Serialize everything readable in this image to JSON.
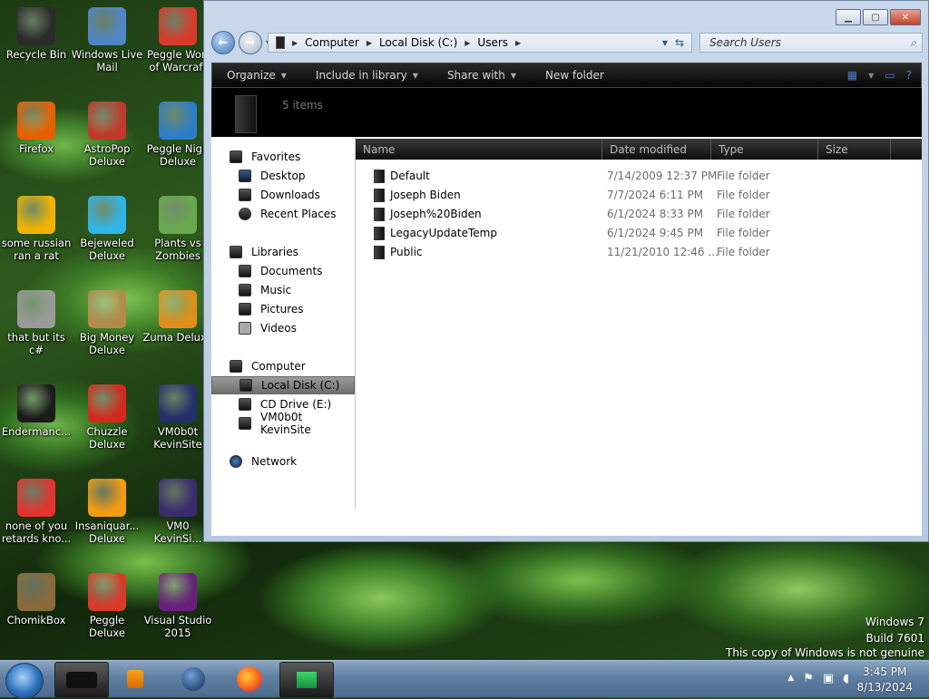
{
  "desktop": {
    "icons": [
      {
        "label": "Recycle Bin",
        "icon": "recycle-bin-icon",
        "color": "#2b2b2b"
      },
      {
        "label": "Windows Live\nMail",
        "icon": "mail-icon",
        "color": "#4f86c6"
      },
      {
        "label": "Peggle Worl\nof Warcraft",
        "icon": "peggle-icon",
        "color": "#d83a2a"
      },
      {
        "label": "Firefox",
        "icon": "firefox-icon",
        "color": "#e66000"
      },
      {
        "label": "AstroPop\nDeluxe",
        "icon": "astropop-icon",
        "color": "#c0392b"
      },
      {
        "label": "Peggle Nigh\nDeluxe",
        "icon": "peggle-nights-icon",
        "color": "#2d7ec7"
      },
      {
        "label": "some russian\nran a rat",
        "icon": "de-icon",
        "color": "#f0b400"
      },
      {
        "label": "Bejeweled\nDeluxe",
        "icon": "diamond-icon",
        "color": "#2fb5e8"
      },
      {
        "label": "Plants vs\nZombies",
        "icon": "flower-icon",
        "color": "#6aa84f"
      },
      {
        "label": "that but its c#",
        "icon": "copies-icon",
        "color": "#9a9a9a"
      },
      {
        "label": "Big Money\nDeluxe",
        "icon": "money-bag-icon",
        "color": "#b38a4a"
      },
      {
        "label": "Zuma Deluxe",
        "icon": "zuma-icon",
        "color": "#e0901a"
      },
      {
        "label": "Endermanc...",
        "icon": "terminal-icon",
        "color": "#1b1b1b"
      },
      {
        "label": "Chuzzle\nDeluxe",
        "icon": "chuzzle-icon",
        "color": "#d42a1e"
      },
      {
        "label": "VM0b0t\nKevinSite",
        "icon": "vm-icon",
        "color": "#23306b"
      },
      {
        "label": "none of you\nretards kno...",
        "icon": "dragon-icon",
        "color": "#e3342f"
      },
      {
        "label": "Insaniquar...\nDeluxe",
        "icon": "fish-icon",
        "color": "#f39c12"
      },
      {
        "label": "VM0\nKevinSi...",
        "icon": "vm-firefox-icon",
        "color": "#3b2b6e"
      },
      {
        "label": "ChomikBox",
        "icon": "hamster-box-icon",
        "color": "#8b6a3a"
      },
      {
        "label": "Peggle Deluxe",
        "icon": "peggle-deluxe-icon",
        "color": "#d83a2a"
      },
      {
        "label": "Visual Studio\n2015",
        "icon": "visual-studio-icon",
        "color": "#68217a"
      }
    ],
    "watermark": {
      "line1": "Windows 7",
      "line2": "Build 7601",
      "line3": "This copy of Windows is not genuine"
    }
  },
  "explorer": {
    "address": {
      "crumbs": [
        "Computer",
        "Local Disk (C:)",
        "Users"
      ]
    },
    "search": {
      "placeholder": "Search Users"
    },
    "toolbar": {
      "organize": "Organize",
      "include": "Include in library",
      "share": "Share with",
      "new_folder": "New folder"
    },
    "banner": {
      "count": "5 items"
    },
    "nav": {
      "favorites": "Favorites",
      "desktop": "Desktop",
      "downloads": "Downloads",
      "recent": "Recent Places",
      "libraries": "Libraries",
      "documents": "Documents",
      "music": "Music",
      "pictures": "Pictures",
      "videos": "Videos",
      "computer": "Computer",
      "local_disk": "Local Disk (C:)",
      "cd_drive": "CD Drive (E:)",
      "vm_share": "VM0b0t KevinSite",
      "network": "Network"
    },
    "columns": {
      "name": "Name",
      "date": "Date modified",
      "type": "Type",
      "size": "Size"
    },
    "files": [
      {
        "name": "Default",
        "date": "7/14/2009 12:37 PM",
        "type": "File folder"
      },
      {
        "name": "Joseph Biden",
        "date": "7/7/2024 6:11 PM",
        "type": "File folder"
      },
      {
        "name": "Joseph%20Biden",
        "date": "6/1/2024 8:33 PM",
        "type": "File folder"
      },
      {
        "name": "LegacyUpdateTemp",
        "date": "6/1/2024 9:45 PM",
        "type": "File folder"
      },
      {
        "name": "Public",
        "date": "11/21/2010 12:46 ...",
        "type": "File folder"
      }
    ]
  },
  "taskbar": {
    "clock_time": "3:45 PM",
    "clock_date": "8/13/2024"
  }
}
